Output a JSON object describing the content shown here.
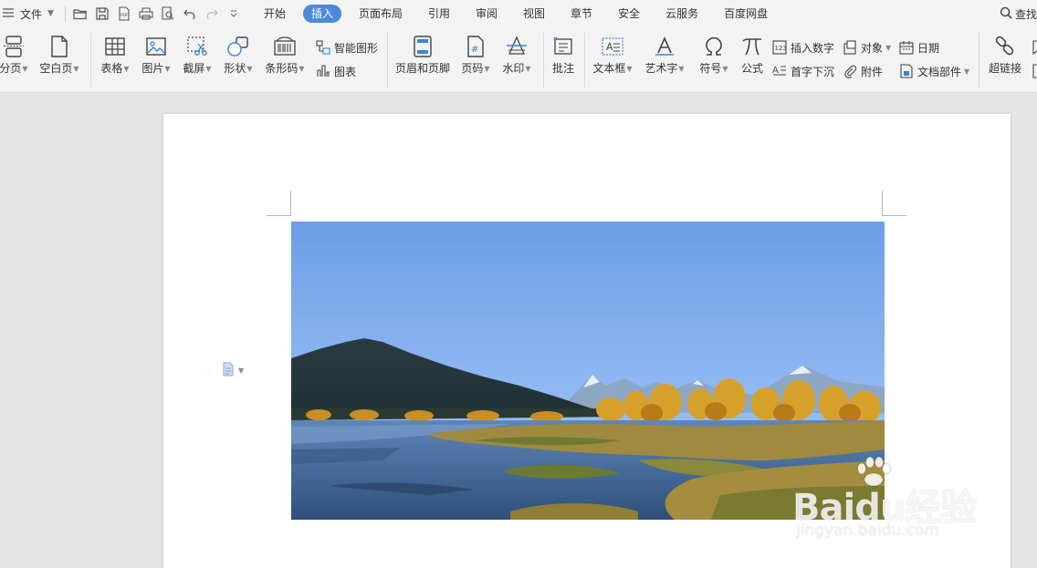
{
  "menubar": {
    "file_label": "文件",
    "tabs": [
      "开始",
      "插入",
      "页面布局",
      "引用",
      "审阅",
      "视图",
      "章节",
      "安全",
      "云服务",
      "百度网盘"
    ],
    "active_tab": "插入",
    "search_label": "查找"
  },
  "ribbon": {
    "page_break": "分页",
    "blank_page": "空白页",
    "table": "表格",
    "picture": "图片",
    "screenshot": "截屏",
    "shape": "形状",
    "barcode": "条形码",
    "smart_graphic": "智能图形",
    "chart": "图表",
    "header_footer": "页眉和页脚",
    "page_number": "页码",
    "watermark": "水印",
    "comment": "批注",
    "text_box": "文本框",
    "word_art": "艺术字",
    "symbol": "符号",
    "formula": "公式",
    "insert_number": "插入数字",
    "drop_cap": "首字下沉",
    "object": "对象",
    "attachment": "附件",
    "date": "日期",
    "doc_parts": "文档部件",
    "hyperlink": "超链接"
  },
  "document": {
    "image_alt": "Mountain lake landscape with autumn trees"
  },
  "watermark": {
    "brand": "Baidu经验",
    "url": "jingyan.baidu.com"
  },
  "colors": {
    "accent": "#4b8ad8",
    "toolbar_bg": "#f3f3f3",
    "canvas_bg": "#e6e6e6"
  }
}
